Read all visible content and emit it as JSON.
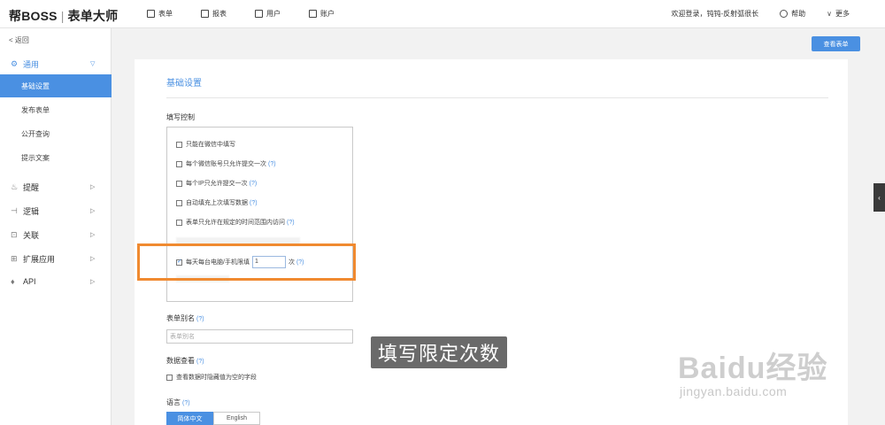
{
  "brand": {
    "name": "帮BOSS",
    "product": "表单大师"
  },
  "nav": [
    {
      "label": "表单",
      "icon": "form-icon"
    },
    {
      "label": "报表",
      "icon": "chart-icon"
    },
    {
      "label": "用户",
      "icon": "user-icon"
    },
    {
      "label": "账户",
      "icon": "account-icon"
    }
  ],
  "header_right": {
    "welcome": "欢迎登录，钝钝-反射弧很长",
    "help": "帮助",
    "more": "更多"
  },
  "sidebar": {
    "back": "返回",
    "general": "通用",
    "sub_items": [
      "基础设置",
      "发布表单",
      "公开查询",
      "提示文案"
    ],
    "groups": [
      "提醒",
      "逻辑",
      "关联",
      "扩展应用",
      "API"
    ]
  },
  "view_form_button": "查看表单",
  "main": {
    "title": "基础设置",
    "fill_control_label": "填写控制",
    "options": [
      {
        "label": "只能在微信中填写",
        "checked": false,
        "help": ""
      },
      {
        "label": "每个微信账号只允许提交一次",
        "checked": false,
        "help": "(?)"
      },
      {
        "label": "每个IP只允许提交一次",
        "checked": false,
        "help": "(?)"
      },
      {
        "label": "自动填充上次填写数据",
        "checked": false,
        "help": "(?)"
      },
      {
        "label": "表单只允许在规定的时间范围内访问",
        "checked": false,
        "help": "(?)"
      }
    ],
    "daily_limit": {
      "label": "每天每台电脑/手机限填",
      "value": "1",
      "unit": "次",
      "help": "(?)",
      "checked": true
    },
    "alias_label": "表单别名",
    "alias_help": "(?)",
    "alias_placeholder": "表单别名",
    "data_view_label": "数据查看",
    "data_view_help": "(?)",
    "hide_empty_label": "查看数据时隐藏值为空的字段",
    "language_label": "语言",
    "language_help": "(?)",
    "languages": [
      "简体中文",
      "English"
    ],
    "selected_language": "简体中文"
  },
  "caption": "填写限定次数",
  "watermark": {
    "main": "Baidu经验",
    "sub": "jingyan.baidu.com"
  }
}
